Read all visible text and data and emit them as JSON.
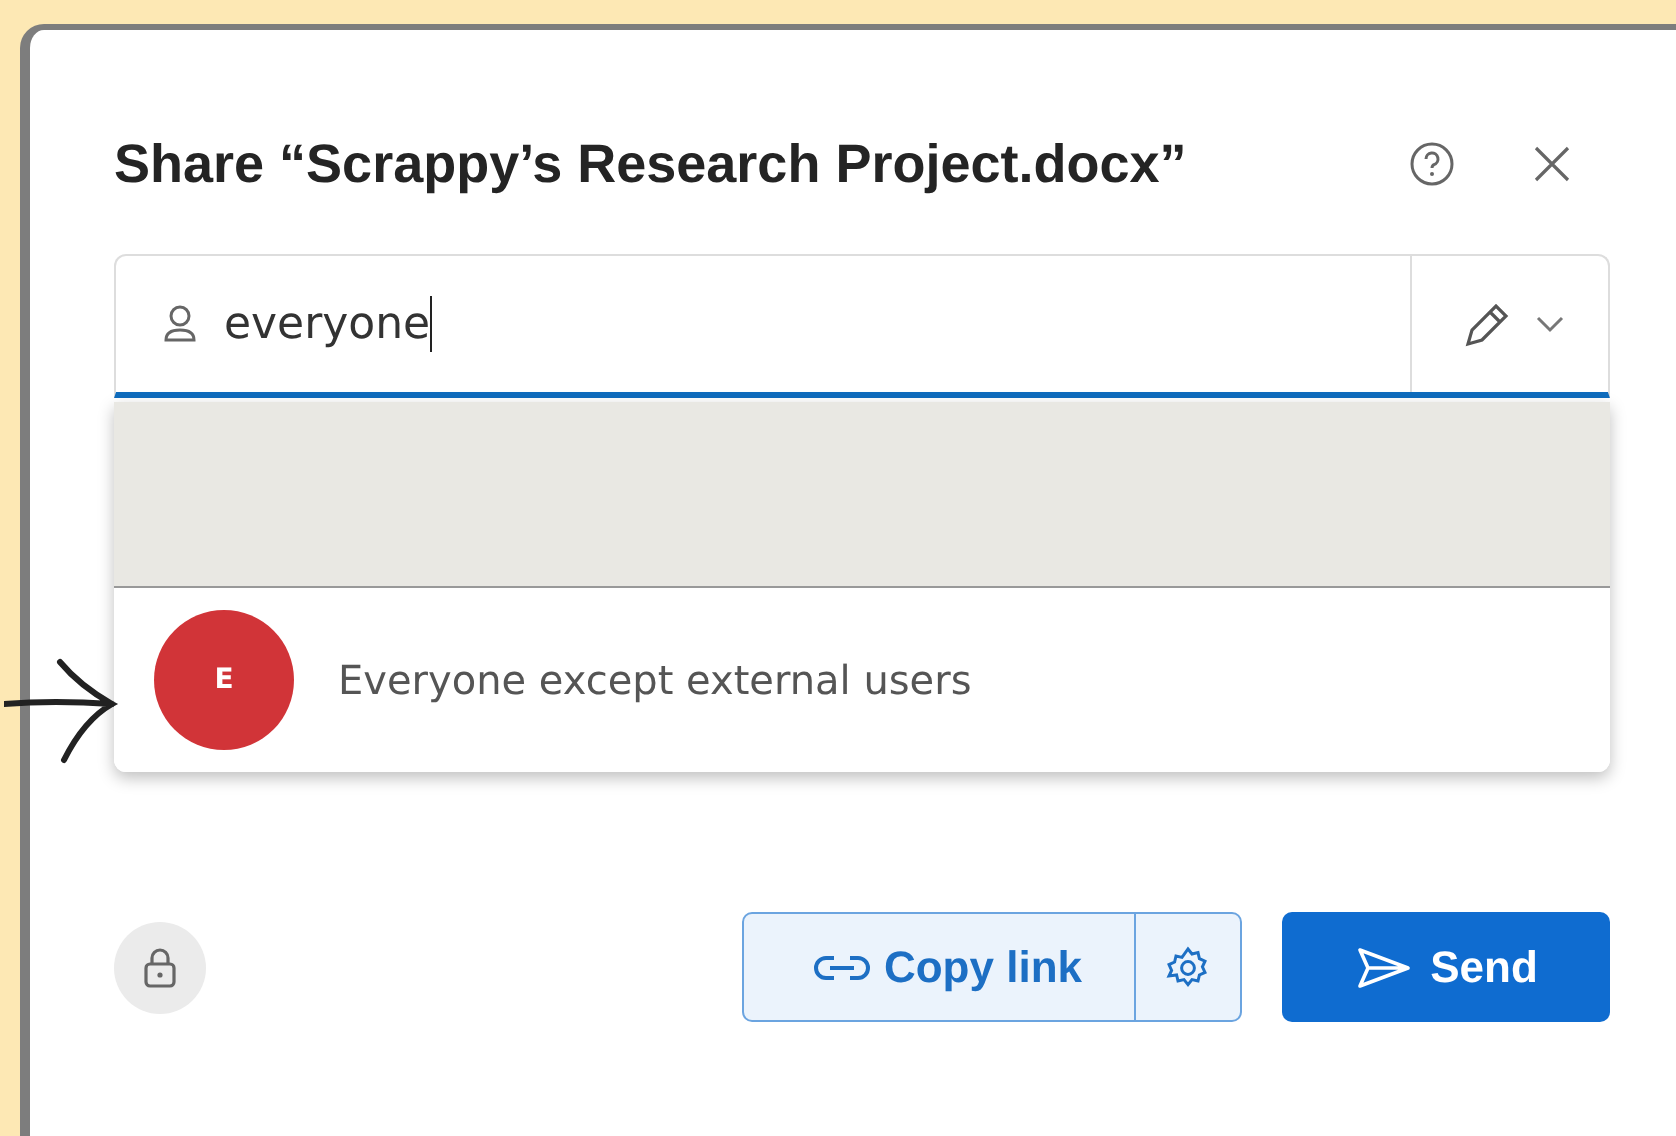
{
  "dialog": {
    "title": "Share “Scrappy’s Research Project.docx”"
  },
  "search": {
    "value": "everyone"
  },
  "suggestions": [
    {
      "kind": "blank"
    },
    {
      "kind": "person",
      "initial": "E",
      "name": "Everyone except external users"
    }
  ],
  "buttons": [
    {
      "kind": "copy_link",
      "label": "Copy link"
    },
    {
      "kind": "send",
      "label": "Send"
    }
  ]
}
